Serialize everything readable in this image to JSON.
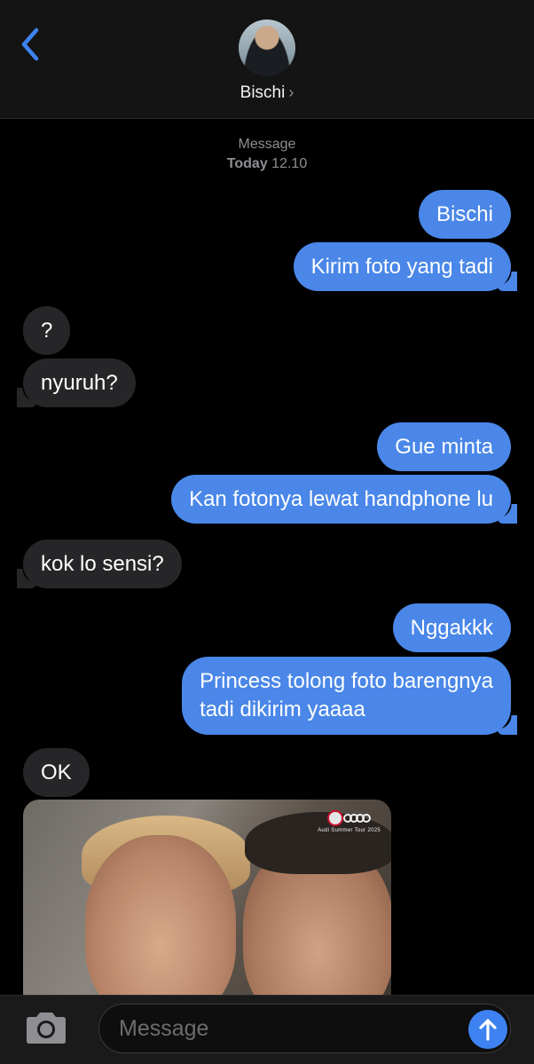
{
  "header": {
    "contact_name": "Bischi",
    "chevron": "›",
    "back_icon": "chevron-left-icon"
  },
  "meta": {
    "service": "Message",
    "day": "Today",
    "time": "12.10"
  },
  "messages": [
    {
      "from": "me",
      "text": "Bischi"
    },
    {
      "from": "me",
      "text": "Kirim foto yang tadi"
    },
    {
      "from": "them",
      "text": "?"
    },
    {
      "from": "them",
      "text": "nyuruh?"
    },
    {
      "from": "me",
      "text": "Gue minta"
    },
    {
      "from": "me",
      "text": "Kan fotonya lewat handphone lu"
    },
    {
      "from": "them",
      "text": "kok lo sensi?"
    },
    {
      "from": "me",
      "text": "Nggakkk"
    },
    {
      "from": "me",
      "text": "Princess tolong foto barengnya\ntadi dikirim yaaaa"
    },
    {
      "from": "them",
      "text": "OK"
    }
  ],
  "photo": {
    "caption_text": "Audi Summer Tour 2025"
  },
  "composer": {
    "placeholder": "Message",
    "camera_icon": "camera-icon",
    "send_icon": "arrow-up-icon"
  },
  "colors": {
    "sent_bubble": "#4a87e8",
    "received_bubble": "#262628",
    "accent": "#3d82f0"
  }
}
